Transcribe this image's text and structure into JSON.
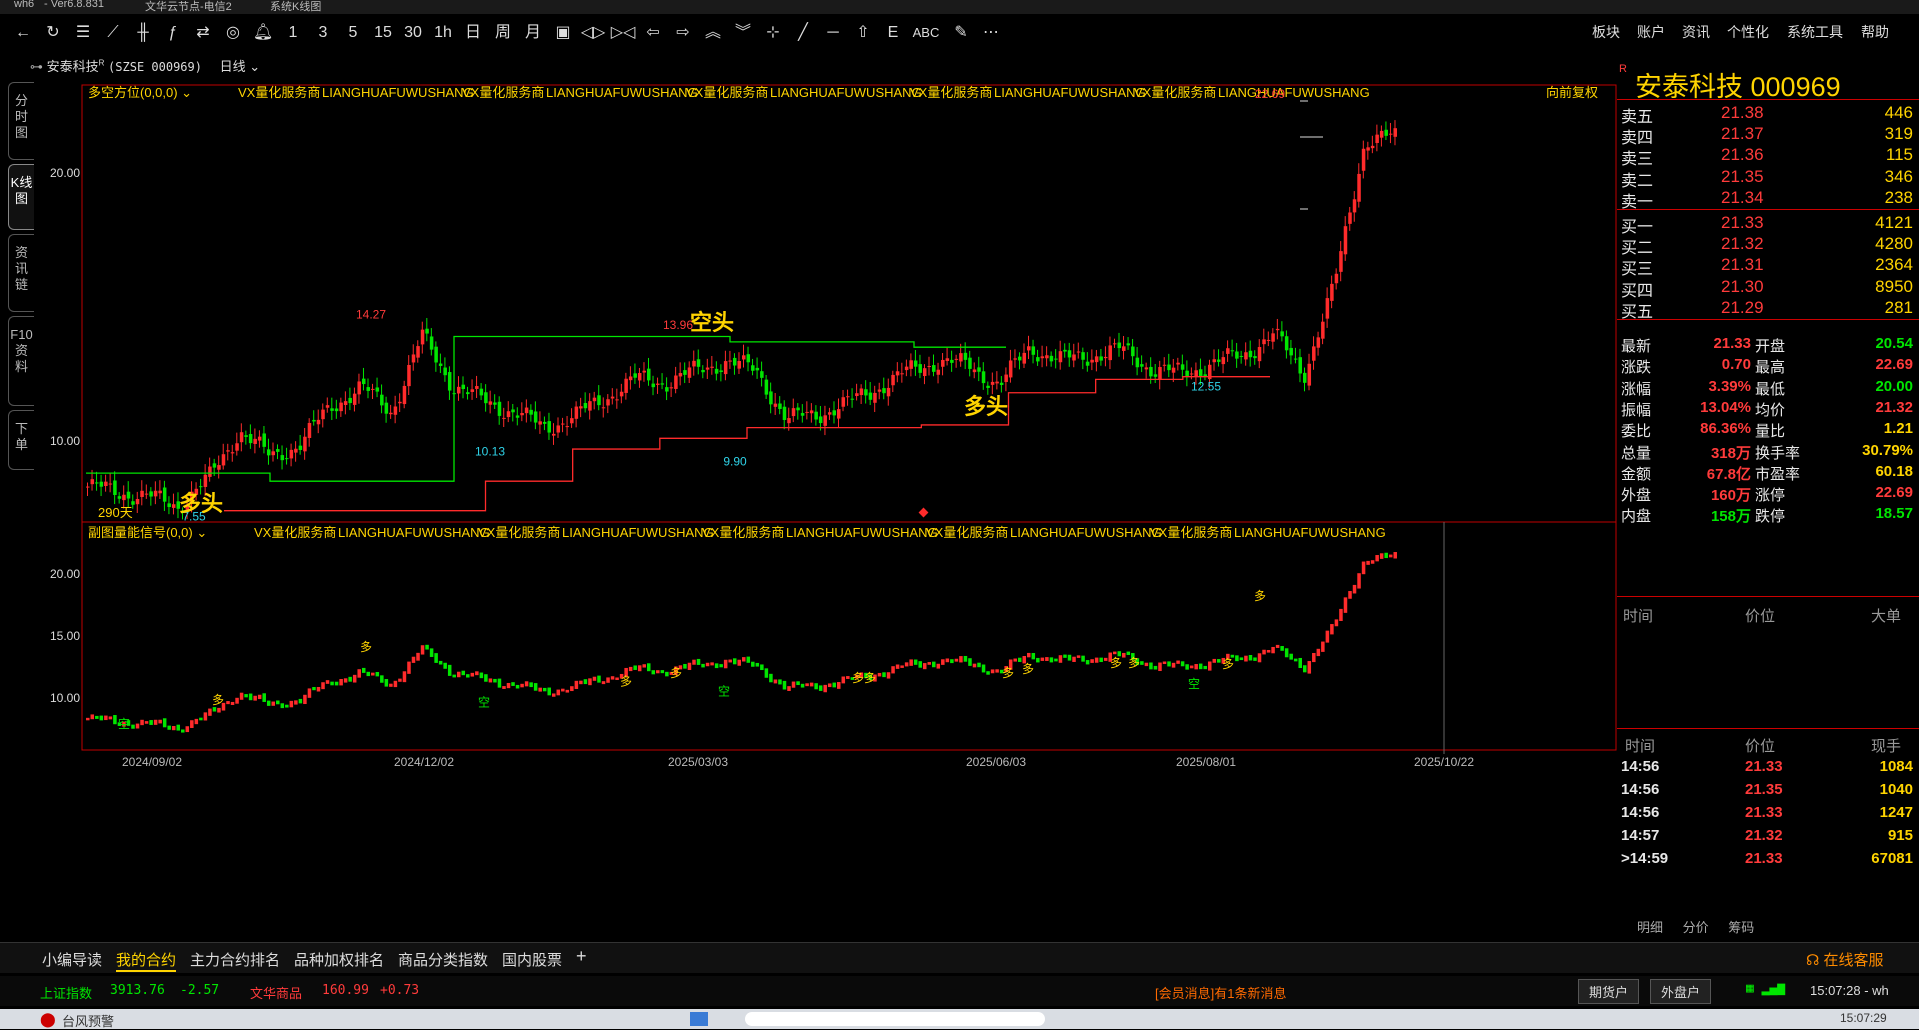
{
  "titlebar": {
    "app": "wh6",
    "version": "- Ver6.8.831",
    "server": "文华云节点-电信2",
    "window": "系统K线图"
  },
  "toolbar": {
    "periods": [
      "1",
      "3",
      "5",
      "15",
      "30",
      "1h",
      "日",
      "周",
      "月"
    ],
    "abc": "ABC",
    "right_menu": [
      "板块",
      "账户",
      "资讯",
      "个性化",
      "系统工具",
      "帮助"
    ]
  },
  "stock_bar": {
    "name": "安泰科技",
    "code": "(SZSE 000969)",
    "period": "日线"
  },
  "side_tabs": [
    "分时图",
    "K线图",
    "资讯链",
    "F10资料",
    "下单"
  ],
  "main_panel": {
    "indicator": "多空方位(0,0,0)",
    "ads": [
      "VX量化服务商",
      "LIANGHUAFUWUSHANG",
      "VX量化服务商",
      "LIANGHUAFUWUSHANG",
      "VX量化服务商",
      "LIANGHUAFUWUSHANG",
      "VX量化服务商",
      "LIANGHUAFUWUSHANG",
      "VX量化服务商",
      "LIANGHUAFUWUSHANG"
    ],
    "adjust": "向前复权",
    "y_labels": [
      "20.00",
      "10.00"
    ],
    "days_label": "290天",
    "price_labels": [
      "14.27",
      "13.96",
      "10.13",
      "9.90",
      "7.55",
      "12.55",
      "22.69"
    ],
    "signals": [
      "多头",
      "空头",
      "多头"
    ]
  },
  "sub_panel": {
    "indicator": "副图量能信号(0,0)",
    "ads": [
      "VX量化服务商",
      "LIANGHUAFUWUSHANG",
      "VX量化服务商",
      "LIANGHUAFUWUSHANG",
      "VX量化服务商",
      "LIANGHUAFUWUSHANG",
      "VX量化服务商",
      "LIANGHUAFUWUSHANG",
      "VX量化服务商",
      "LIANGHUAFUWUSHANG"
    ],
    "y_labels": [
      "20.00",
      "15.00",
      "10.00"
    ],
    "signal_duo": "多",
    "signal_kong": "空"
  },
  "x_axis": [
    "2024/09/02",
    "2024/12/02",
    "2025/03/03",
    "2025/06/03",
    "2025/08/01",
    "2025/10/22"
  ],
  "chart_data": {
    "type": "candlestick",
    "title": "安泰科技 000969 日线",
    "ylim_main": [
      7,
      23
    ],
    "annotated_prices": {
      "high_2024_12": 14.27,
      "high_2025_03": 13.96,
      "low_2025_01": 10.13,
      "low_2025_04": 9.9,
      "low_2024_09": 7.55,
      "low_2025_09": 12.55,
      "high_2025_10": 22.69
    },
    "x_ticks": [
      "2024/09/02",
      "2024/12/02",
      "2025/03/03",
      "2025/06/03",
      "2025/08/01",
      "2025/10/22"
    ],
    "close_path": [
      8.3,
      8.1,
      7.9,
      7.6,
      8.6,
      10.4,
      9.4,
      9.9,
      11.3,
      12.0,
      11.1,
      13.9,
      12.1,
      11.5,
      11.1,
      10.5,
      10.9,
      11.6,
      12.3,
      12.2,
      12.6,
      13.0,
      12.6,
      10.8,
      11.0,
      11.4,
      12.0,
      12.6,
      13.0,
      12.8,
      12.1,
      13.5,
      13.0,
      13.2,
      13.4,
      12.7,
      12.5,
      12.9,
      13.2,
      14.0,
      12.5,
      15.8,
      21.2,
      21.33
    ],
    "upper_line": [
      8.8,
      8.8,
      8.5,
      8.5,
      13.9,
      13.9,
      13.9,
      13.7,
      13.7,
      13.5
    ],
    "lower_line": [
      7.4,
      7.4,
      7.4,
      8.5,
      9.7,
      10.1,
      10.5,
      10.5,
      10.6,
      11.8,
      12.3,
      12.4
    ]
  },
  "quote": {
    "name": "安泰科技",
    "code": "000969",
    "asks": [
      {
        "label": "卖五",
        "price": "21.38",
        "vol": "446"
      },
      {
        "label": "卖四",
        "price": "21.37",
        "vol": "319"
      },
      {
        "label": "卖三",
        "price": "21.36",
        "vol": "115"
      },
      {
        "label": "卖二",
        "price": "21.35",
        "vol": "346"
      },
      {
        "label": "卖一",
        "price": "21.34",
        "vol": "238"
      }
    ],
    "bids": [
      {
        "label": "买一",
        "price": "21.33",
        "vol": "4121"
      },
      {
        "label": "买二",
        "price": "21.32",
        "vol": "4280"
      },
      {
        "label": "买三",
        "price": "21.31",
        "vol": "2364"
      },
      {
        "label": "买四",
        "price": "21.30",
        "vol": "8950"
      },
      {
        "label": "买五",
        "price": "21.29",
        "vol": "281"
      }
    ],
    "stats": [
      {
        "l1": "最新",
        "v1": "21.33",
        "l2": "开盘",
        "v2": "20.54"
      },
      {
        "l1": "涨跌",
        "v1": "0.70",
        "l2": "最高",
        "v2": "22.69"
      },
      {
        "l1": "涨幅",
        "v1": "3.39%",
        "l2": "最低",
        "v2": "20.00"
      },
      {
        "l1": "振幅",
        "v1": "13.04%",
        "l2": "均价",
        "v2": "21.32"
      },
      {
        "l1": "委比",
        "v1": "86.36%",
        "l2": "量比",
        "v2": "1.21"
      },
      {
        "l1": "总量",
        "v1": "318万",
        "l2": "换手率",
        "v2": "30.79%"
      },
      {
        "l1": "金额",
        "v1": "67.8亿",
        "l2": "市盈率",
        "v2": "60.18"
      },
      {
        "l1": "外盘",
        "v1": "160万",
        "l2": "涨停",
        "v2": "22.69"
      },
      {
        "l1": "内盘",
        "v1": "158万",
        "l2": "跌停",
        "v2": "18.57"
      }
    ],
    "big_header": {
      "time": "时间",
      "price": "价位",
      "big": "大单"
    },
    "tick_header": {
      "time": "时间",
      "price": "价位",
      "vol": "现手"
    },
    "ticks": [
      {
        "time": "14:56",
        "price": "21.33",
        "vol": "1084"
      },
      {
        "time": "14:56",
        "price": "21.35",
        "vol": "1040"
      },
      {
        "time": "14:56",
        "price": "21.33",
        "vol": "1247"
      },
      {
        "time": "14:57",
        "price": "21.32",
        "vol": "915"
      },
      {
        "time": ">14:59",
        "price": "21.33",
        "vol": "67081"
      }
    ],
    "bottom_tabs": [
      "明细",
      "分价",
      "筹码"
    ]
  },
  "bottom_tabs": [
    "小编导读",
    "我的合约",
    "主力合约排名",
    "品种加权排名",
    "商品分类指数",
    "国内股票"
  ],
  "add_tab": "+",
  "service": "在线客服",
  "status": {
    "idx1_name": "上证指数",
    "idx1_val": "3913.76",
    "idx1_chg": "-2.57",
    "idx2_name": "文华商品",
    "idx2_val": "160.99",
    "idx2_chg": "+0.73",
    "message": "[会员消息]有1条新消息",
    "btn1": "期货户",
    "btn2": "外盘户",
    "clock": "15:07:28 - wh"
  },
  "taskbar": {
    "notice": "台风预警",
    "clock": "15:07:29"
  },
  "colors": {
    "up": "#ff3b3b",
    "down": "#00e600",
    "accent": "#ffd400",
    "border": "#c00000",
    "cyan": "#2fd3e8"
  }
}
